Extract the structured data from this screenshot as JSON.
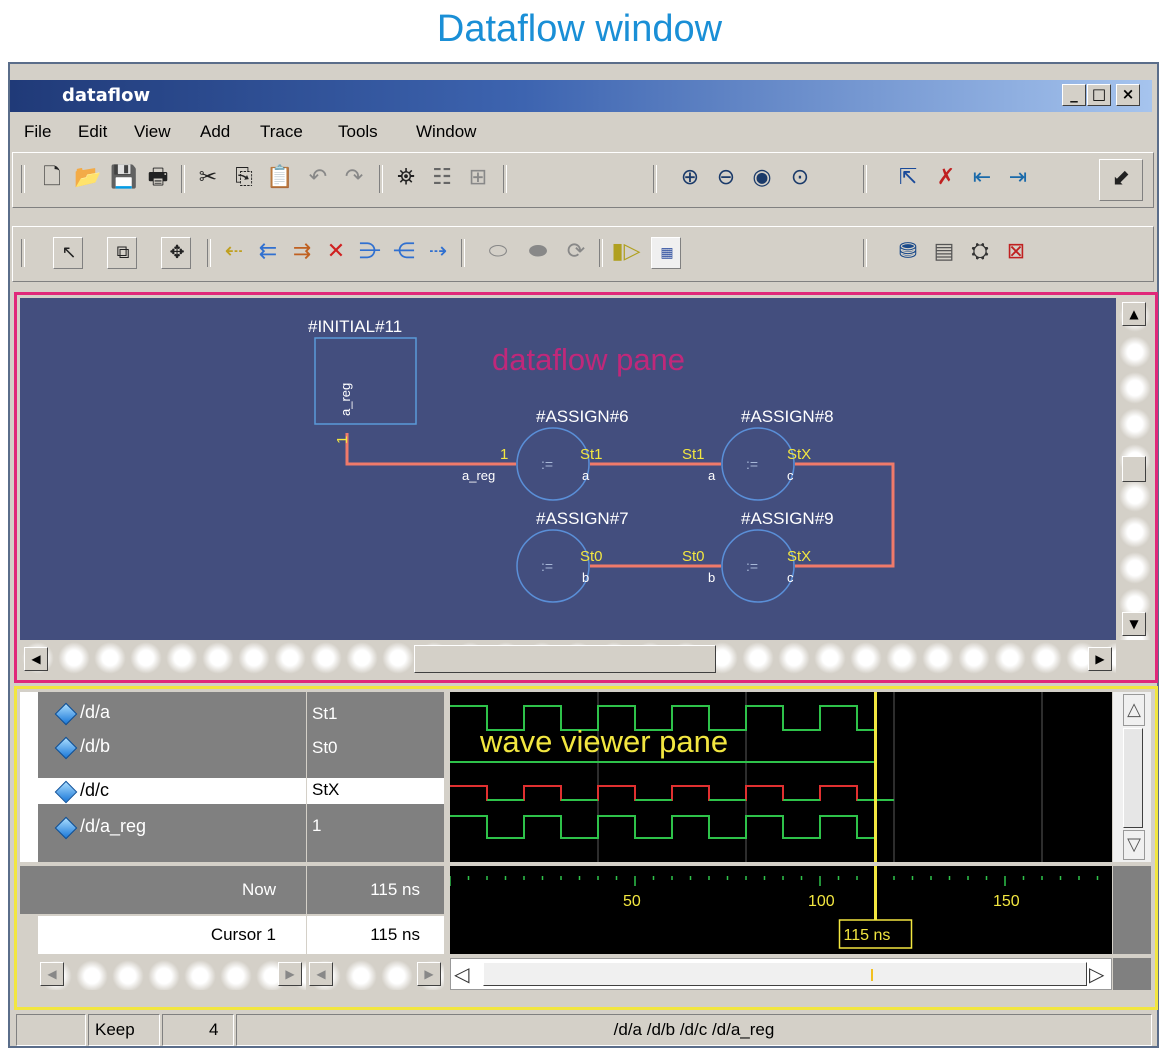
{
  "caption": "Dataflow window",
  "window": {
    "title": "dataflow",
    "minimize": "_",
    "maximize": "□",
    "close": "×"
  },
  "menu": [
    "File",
    "Edit",
    "View",
    "Add",
    "Trace",
    "Tools",
    "Window"
  ],
  "toolbar_icons": {
    "row1": [
      "new-file-icon",
      "open-folder-icon",
      "save-icon",
      "print-icon",
      "cut-icon",
      "copy-icon",
      "paste-icon",
      "undo-icon",
      "redo-icon",
      "find-icon",
      "collapse-icon",
      "expand-icon",
      "zoom-in-icon",
      "zoom-out-icon",
      "zoom-full-icon",
      "zoom-area-icon",
      "select-trace-icon",
      "delete-trace-icon",
      "trace-back-icon",
      "trace-forward-icon",
      "dock-icon"
    ],
    "row2": [
      "select-mode-icon",
      "zoom-mode-icon",
      "pan-mode-icon",
      "trace-input-icon",
      "trace-set-icon",
      "trace-x-icon",
      "trace-all-icon",
      "trace-expand-icon",
      "trace-up-icon",
      "trace-down-icon",
      "hilite-icon",
      "unhilite-icon",
      "region-icon",
      "step-icon",
      "show-wave-icon",
      "export-icon",
      "stop-icon",
      "select-all-icon",
      "clear-icon"
    ]
  },
  "dataflow": {
    "pane_label": "dataflow pane",
    "initial_block": {
      "name": "#INITIAL#11",
      "port": "a_reg",
      "value": "1"
    },
    "assigns": [
      {
        "name": "#ASSIGN#6",
        "op": ":=",
        "in_port": "a_reg",
        "in_value": "1",
        "out_port": "a",
        "out_value": "St1"
      },
      {
        "name": "#ASSIGN#8",
        "op": ":=",
        "in_port": "a",
        "in_value": "St1",
        "out_port": "c",
        "out_value": "StX"
      },
      {
        "name": "#ASSIGN#7",
        "op": ":=",
        "out_port": "b",
        "out_value": "St0"
      },
      {
        "name": "#ASSIGN#9",
        "op": ":=",
        "in_port": "b",
        "in_value": "St0",
        "out_port": "c",
        "out_value": "StX"
      }
    ],
    "colors": {
      "canvas": "#434e7e",
      "wire": "#f07a6a",
      "value": "#f2e640",
      "node": "#5a8fd8",
      "label": "#ffffff"
    }
  },
  "wave": {
    "pane_label": "wave viewer pane",
    "signals": [
      {
        "name": "/d/a",
        "value": "St1",
        "selected": false,
        "color": "#2ec24a"
      },
      {
        "name": "/d/b",
        "value": "St0",
        "selected": false,
        "color": "#2ec24a"
      },
      {
        "name": "/d/c",
        "value": "StX",
        "selected": true,
        "color": "#e03030"
      },
      {
        "name": "/d/a_reg",
        "value": "1",
        "selected": false,
        "color": "#2ec24a"
      }
    ],
    "now_label": "Now",
    "now_value": "115 ns",
    "cursor_label": "Cursor 1",
    "cursor_value": "115 ns",
    "cursor_badge": "115 ns",
    "time_ticks": [
      "50",
      "100",
      "150"
    ],
    "cursor_time": 115,
    "colors": {
      "background": "#000000",
      "cursor": "#f2e640",
      "grid": "#5a5a5a"
    }
  },
  "status": {
    "field1": "",
    "keep_label": "Keep",
    "keep_value": "4",
    "signals": "/d/a /d/b /d/c /d/a_reg"
  }
}
